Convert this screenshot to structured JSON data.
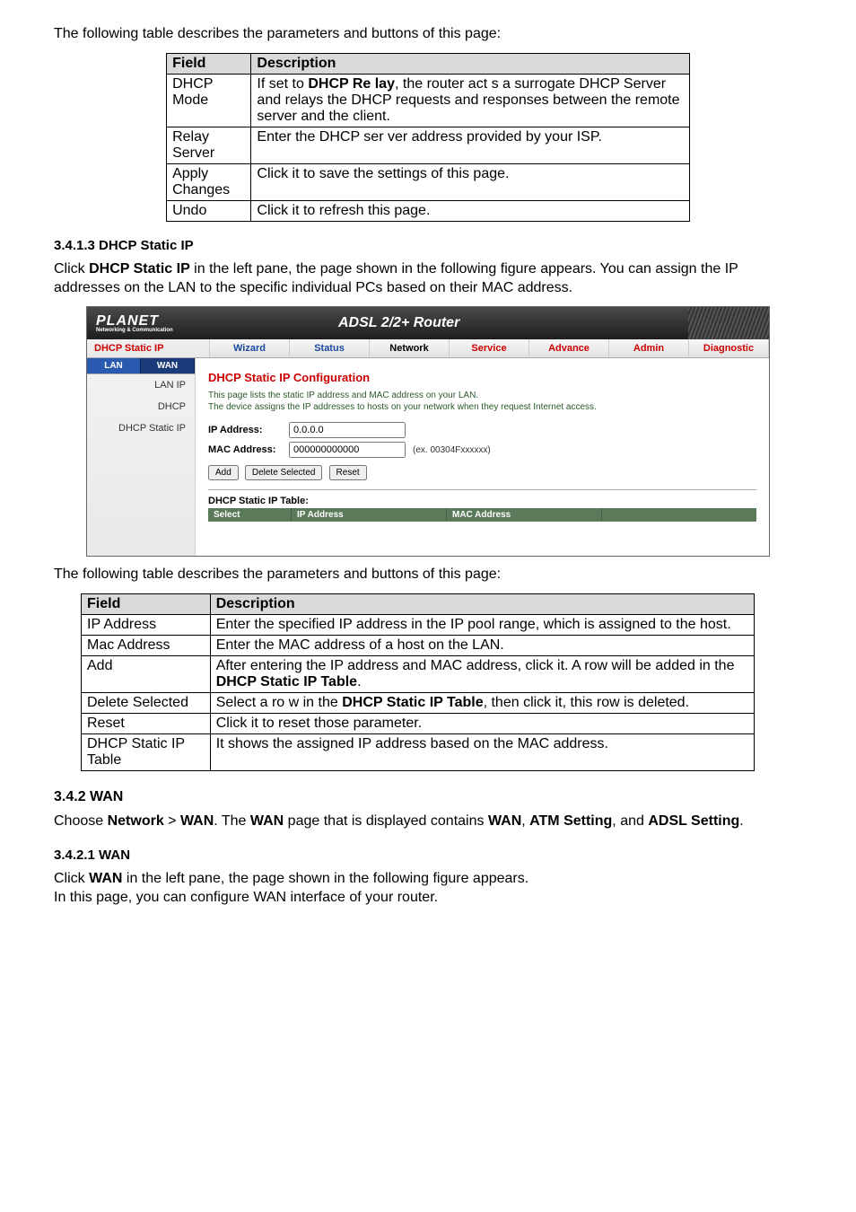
{
  "intro1": "The following table describes the parameters and buttons of this page:",
  "table1": {
    "headers": [
      "Field",
      "Description"
    ],
    "rows": [
      [
        "DHCP Mode",
        "If set to <b>DHCP Re lay</b>, the router act s a surrogate DHCP Server and relays the DHCP requests and responses between the remote server and the client."
      ],
      [
        "Relay Server",
        "Enter the DHCP ser ver address provided by your ISP."
      ],
      [
        "Apply Changes",
        "Click it to save the settings of this page."
      ],
      [
        "Undo",
        "Click it to refresh this page."
      ]
    ]
  },
  "sec1": {
    "heading": "3.4.1.3 DHCP Static IP",
    "para": "Click <b>DHCP Static IP</b> in the left pane, the page shown in the following figure appears. You can assign the IP addresses on the LAN to the specific individual PCs based on their MAC address."
  },
  "router": {
    "logo": "PLANET",
    "logo_sub": "Networking & Communication",
    "product": "ADSL 2/2+ Router",
    "side_label": "DHCP Static IP",
    "nav": [
      "Wizard",
      "Status",
      "Network",
      "Service",
      "Advance",
      "Admin",
      "Diagnostic"
    ],
    "subnav": [
      "LAN",
      "WAN"
    ],
    "side_items": [
      "LAN IP",
      "DHCP",
      "DHCP Static IP"
    ],
    "main_title": "DHCP Static IP Configuration",
    "help1": "This page lists the static IP address and MAC address on your LAN.",
    "help2": "The device assigns the IP addresses to hosts on your network when they request Internet access.",
    "ip_label": "IP Address:",
    "ip_value": "0.0.0.0",
    "mac_label": "MAC Address:",
    "mac_value": "000000000000",
    "mac_hint": "(ex. 00304Fxxxxxx)",
    "btn_add": "Add",
    "btn_del": "Delete Selected",
    "btn_reset": "Reset",
    "tbl_label": "DHCP Static IP Table:",
    "tbl_cols": [
      "Select",
      "IP Address",
      "MAC Address"
    ]
  },
  "intro2": "The following table describes the parameters and buttons of this page:",
  "table2": {
    "headers": [
      "Field",
      "Description"
    ],
    "rows": [
      [
        "IP Address",
        "Enter the specified IP address in the IP pool range, which is assigned to the host."
      ],
      [
        "Mac Address",
        "Enter the MAC address of a host on the LAN."
      ],
      [
        "Add",
        "After entering the IP address and MAC address, click it. A row will be added in the <b>DHCP Static IP Table</b>."
      ],
      [
        "Delete Selected",
        "Select a ro w in the <b>DHCP Static IP Table</b>, then click it, this row is deleted."
      ],
      [
        "Reset",
        "Click it to reset those parameter."
      ],
      [
        "DHCP Static IP Table",
        "It shows the assigned IP address based on the MAC address."
      ]
    ]
  },
  "sec2": {
    "heading": "3.4.2 WAN",
    "para": "Choose <b>Network</b> > <b>WAN</b>. The <b>WAN</b> page that is displayed contains <b>WAN</b>, <b>ATM Setting</b>, and <b>ADSL Setting</b>."
  },
  "sec3": {
    "heading": "3.4.2.1 WAN",
    "para1": "Click <b>WAN</b> in the left pane, the page shown in the following figure appears.",
    "para2": "In this page, you can configure WAN interface of your router."
  }
}
